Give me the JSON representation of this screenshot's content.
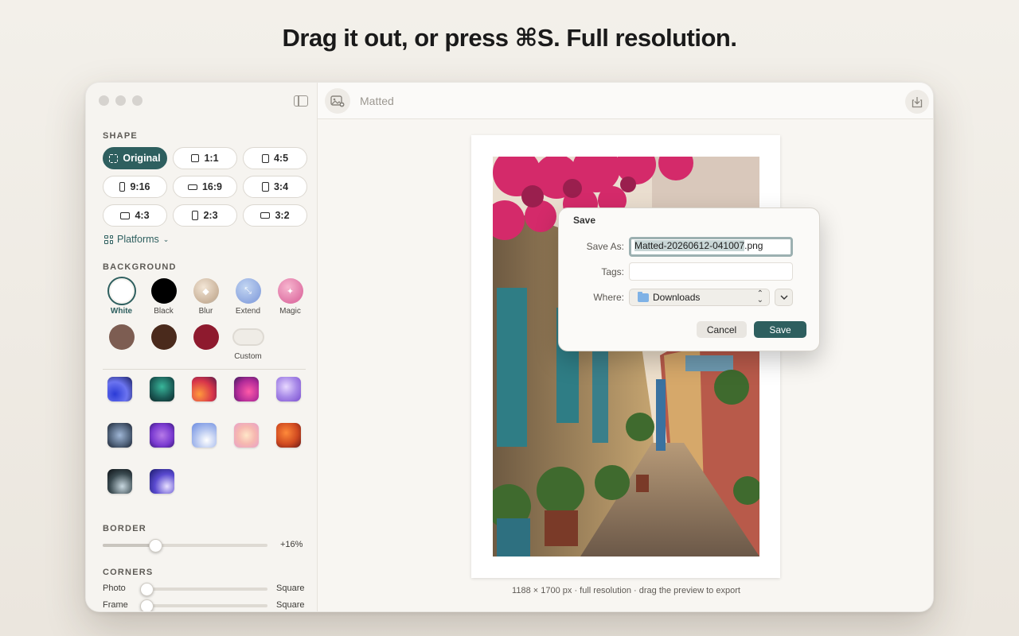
{
  "headline": "Drag it out, or press ⌘S. Full resolution.",
  "app": {
    "title": "Matted"
  },
  "sidebar": {
    "shape": {
      "label": "SHAPE",
      "options": [
        {
          "label": "Original",
          "icon": "dashed-frame-icon",
          "active": true
        },
        {
          "label": "1:1",
          "icon": "square-icon"
        },
        {
          "label": "4:5",
          "icon": "portrait-rect-icon"
        },
        {
          "label": "9:16",
          "icon": "tall-rect-icon"
        },
        {
          "label": "16:9",
          "icon": "wide-rect-icon"
        },
        {
          "label": "3:4",
          "icon": "portrait-rect-icon"
        },
        {
          "label": "4:3",
          "icon": "landscape-rect-icon"
        },
        {
          "label": "2:3",
          "icon": "portrait-rect-icon"
        },
        {
          "label": "3:2",
          "icon": "landscape-rect-icon"
        }
      ],
      "platforms_label": "Platforms"
    },
    "background": {
      "label": "BACKGROUND",
      "row1": [
        {
          "label": "White",
          "color": "#ffffff",
          "selected": true
        },
        {
          "label": "Black",
          "color": "#000000"
        },
        {
          "label": "Blur",
          "icon": "droplet-icon"
        },
        {
          "label": "Extend",
          "icon": "expand-arrows-icon"
        },
        {
          "label": "Magic",
          "icon": "sparkle-icon"
        }
      ],
      "row2": [
        {
          "label": "",
          "color": "#7d5d52"
        },
        {
          "label": "",
          "color": "#4a2a1c"
        },
        {
          "label": "",
          "color": "#8e1a2e"
        },
        {
          "label": "Custom"
        }
      ]
    },
    "border": {
      "label": "BORDER",
      "value_text": "+16%",
      "value": 0.16
    },
    "corners": {
      "label": "CORNERS",
      "photo_label": "Photo",
      "photo_value": "Square",
      "frame_label": "Frame",
      "frame_value": "Square"
    }
  },
  "preview": {
    "caption": "1188 × 1700 px · full resolution · drag the preview to export"
  },
  "save_dialog": {
    "title": "Save",
    "save_as_label": "Save As:",
    "filename_selected": "Matted-20260612-041007",
    "filename_ext": ".png",
    "tags_label": "Tags:",
    "tags_value": "",
    "where_label": "Where:",
    "where_value": "Downloads",
    "cancel_label": "Cancel",
    "save_label": "Save"
  },
  "colors": {
    "accent": "#2e5f5f"
  }
}
